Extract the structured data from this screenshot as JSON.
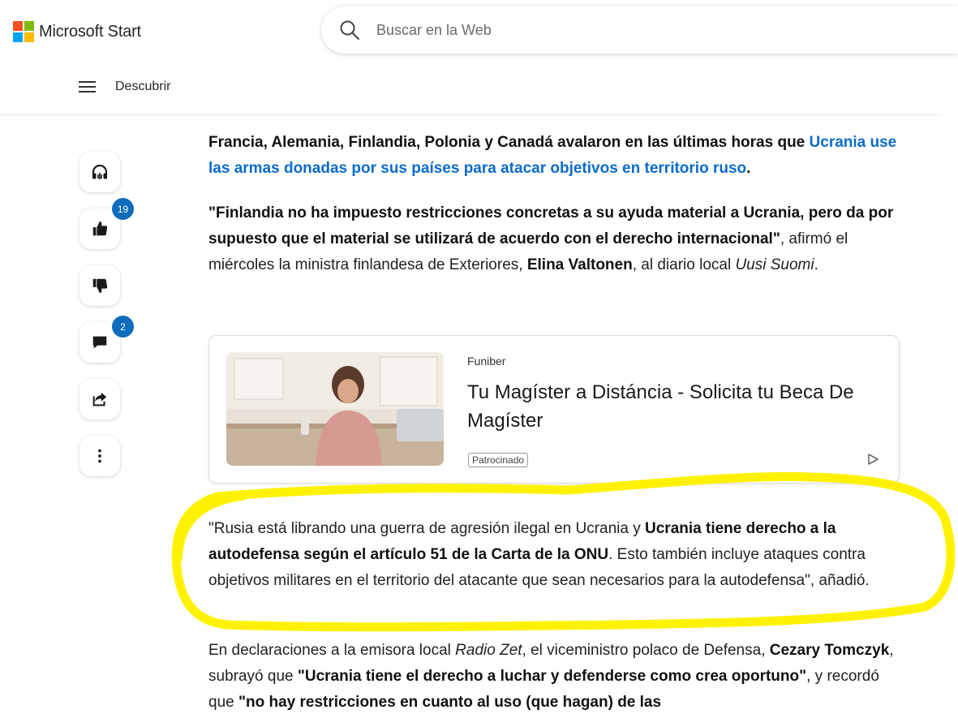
{
  "header": {
    "brand": "Microsoft Start",
    "search_placeholder": "Buscar en la Web",
    "nav_label": "Descubrir"
  },
  "colors": {
    "ms_red": "#f25022",
    "ms_green": "#7fba00",
    "ms_blue": "#00a4ef",
    "ms_yellow": "#ffb900",
    "link": "#0b6bcb",
    "badge": "#0f6cbd",
    "highlight": "#fff200"
  },
  "rail": {
    "listen_icon": "headphones-icon",
    "like_icon": "thumbs-up-icon",
    "like_count": "19",
    "dislike_icon": "thumbs-down-icon",
    "comment_icon": "comment-icon",
    "comment_count": "2",
    "share_icon": "share-icon",
    "more_icon": "more-vertical-icon"
  },
  "article": {
    "p1_bold": "Francia, Alemania, Finlandia, Polonia y Canadá avalaron en las últimas horas que ",
    "p1_link": "Ucrania use las armas donadas por sus países para atacar objetivos en territorio ruso",
    "p1_end": ".",
    "p2_quote": "\"Finlandia no ha impuesto restricciones concretas a su ayuda material a Ucrania, pero da por supuesto que el material se utilizará de acuerdo con el derecho internacional\"",
    "p2_a": ", afirmó el miércoles la ministra finlandesa de Exteriores, ",
    "p2_name": "Elina Valtonen",
    "p2_b": ", al diario local ",
    "p2_paper": "Uusi Suomi",
    "p2_end": ".",
    "p3_a": "\"Rusia está librando una guerra de agresión ilegal en Ucrania y ",
    "p3_bold": "Ucrania tiene derecho a la autodefensa según el artículo 51 de la Carta de la ONU",
    "p3_b": ". Esto también incluye ataques contra objetivos militares en el territorio del atacante que sean necesarios para la autodefensa\", añadió.",
    "p4_a": "En declaraciones a la emisora local ",
    "p4_radio": "Radio Zet",
    "p4_b": ", el viceministro polaco de Defensa, ",
    "p4_name": "Cezary Tomczyk",
    "p4_c": ", subrayó que ",
    "p4_quote1": "\"Ucrania tiene el derecho a luchar y defenderse como crea oportuno\"",
    "p4_d": ", y recordó que ",
    "p4_quote2": "\"no hay restricciones en cuanto al uso (que hagan) de las"
  },
  "ad": {
    "source": "Funiber",
    "title": "Tu Magíster a Distáncia - Solicita tu Beca De Magíster",
    "tag": "Patrocinado"
  }
}
